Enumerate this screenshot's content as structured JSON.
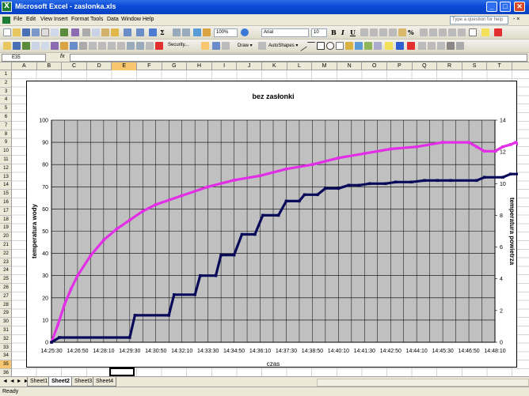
{
  "window": {
    "title": "Microsoft Excel - zaslonka.xls",
    "app_icon_glyph": "X",
    "minimize_glyph": "_",
    "maximize_glyph": "□",
    "close_glyph": "✕"
  },
  "menu": {
    "items": [
      "File",
      "Edit",
      "View",
      "Insert",
      "Format",
      "Tools",
      "Data",
      "Window",
      "Help"
    ],
    "ask_placeholder": "Type a question for help",
    "doc_controls": "- ×"
  },
  "toolbar": {
    "zoom": "100%",
    "font_name": "Arial",
    "font_size": "10",
    "security_label": "Security...",
    "draw_label": "Draw ▾",
    "autoshapes_label": "AutoShapes ▾",
    "bold_glyph": "B",
    "italic_glyph": "I",
    "underline_glyph": "U",
    "percent_glyph": "%",
    "sigma_glyph": "Σ"
  },
  "formula_bar": {
    "name_box": "E35",
    "fx": "fx",
    "formula": ""
  },
  "grid": {
    "columns": [
      "A",
      "B",
      "C",
      "D",
      "E",
      "F",
      "G",
      "H",
      "I",
      "J",
      "K",
      "L",
      "M",
      "N",
      "O",
      "P",
      "Q",
      "R",
      "S",
      "T"
    ],
    "rows": [
      "1",
      "2",
      "3",
      "4",
      "5",
      "6",
      "7",
      "8",
      "9",
      "10",
      "11",
      "12",
      "13",
      "14",
      "15",
      "16",
      "17",
      "18",
      "19",
      "20",
      "21",
      "22",
      "23",
      "24",
      "25",
      "26",
      "27",
      "28",
      "29",
      "30",
      "31",
      "32",
      "33",
      "34",
      "35",
      "36"
    ],
    "selected_column": "E",
    "selected_row": "35"
  },
  "chart_data": {
    "type": "line",
    "title": "bez zasłonki",
    "xlabel": "czas",
    "ylabel": "temperatura wody",
    "y2label": "temperatura powietrza",
    "ylim": [
      0,
      100
    ],
    "y_ticks": [
      0,
      10,
      20,
      30,
      40,
      50,
      60,
      70,
      80,
      90,
      100
    ],
    "y2lim": [
      0,
      14
    ],
    "y2_ticks": [
      0,
      2,
      4,
      6,
      8,
      10,
      12,
      14
    ],
    "x_tick_labels": [
      "14:25:30",
      "14:26:50",
      "14:28:10",
      "14:29:30",
      "14:30:50",
      "14:32:10",
      "14:33:30",
      "14:34:50",
      "14:36:10",
      "14:37:30",
      "14:38:50",
      "14:40:10",
      "14:41:30",
      "14:42:50",
      "14:44:10",
      "14:45:30",
      "14:46:50",
      "14:48:10"
    ],
    "plot_background": "#c0c0c0",
    "grid": true,
    "series": [
      {
        "axis": "left",
        "color": "#e22ee6",
        "x": [
          0,
          0.25,
          0.5,
          0.75,
          1,
          1.5,
          2,
          2.5,
          3,
          3.5,
          4,
          5,
          6,
          7,
          8,
          9,
          10,
          11,
          12,
          13,
          14,
          15,
          16,
          16.3,
          16.6,
          17,
          17.3,
          17.6,
          17.8,
          18
        ],
        "values": [
          0,
          8,
          17,
          24,
          30,
          39,
          46,
          51,
          55,
          59,
          62,
          66,
          70,
          73,
          75,
          78,
          80,
          83,
          85,
          87,
          88,
          90,
          90,
          88,
          86,
          86,
          88,
          89,
          90,
          88
        ]
      },
      {
        "axis": "right",
        "color": "#0a0a5a",
        "x": [
          0,
          0.3,
          3,
          3.2,
          4.5,
          4.7,
          5.5,
          5.7,
          6.3,
          6.5,
          7,
          7.3,
          7.8,
          8.1,
          8.7,
          9,
          9.5,
          9.7,
          10.2,
          10.5,
          11,
          11.4,
          11.8,
          12.2,
          12.8,
          13.2,
          13.8,
          14.3,
          14.8,
          15.3,
          16.3,
          16.6,
          17.3,
          17.6,
          18
        ],
        "values": [
          0,
          0.3,
          0.3,
          1.7,
          1.7,
          3.0,
          3.0,
          4.2,
          4.2,
          5.5,
          5.5,
          6.8,
          6.8,
          8.0,
          8.0,
          8.9,
          8.9,
          9.3,
          9.3,
          9.7,
          9.7,
          9.9,
          9.9,
          10.0,
          10.0,
          10.1,
          10.1,
          10.2,
          10.2,
          10.2,
          10.2,
          10.4,
          10.4,
          10.6,
          10.6
        ]
      }
    ]
  },
  "sheets": {
    "tabs": [
      "Sheet1",
      "Sheet2",
      "Sheet3",
      "Sheet4"
    ],
    "active": "Sheet2",
    "nav": "◄ ◄ ► ►"
  },
  "status": {
    "text": "Ready"
  }
}
